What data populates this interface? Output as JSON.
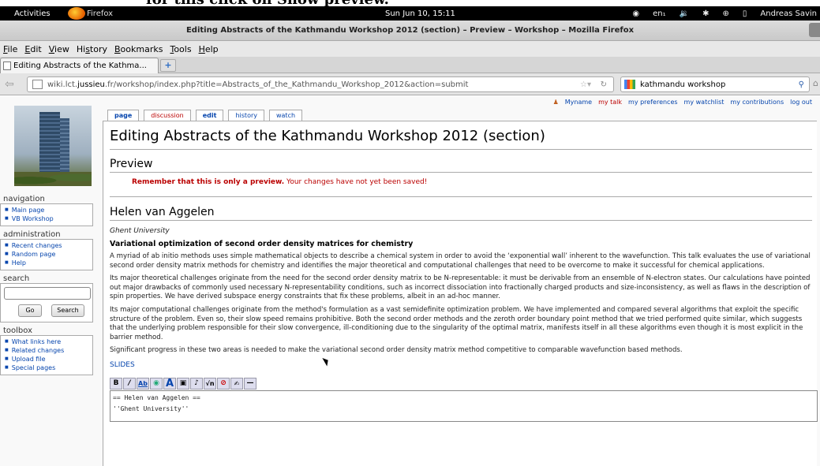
{
  "overlay": {
    "caption": "for this click on Show preview."
  },
  "gnome": {
    "activities": "Activities",
    "app_name": "Firefox",
    "clock": "Sun Jun 10, 15:11",
    "tray": [
      "en₁",
      "🔉",
      "✱",
      "⊕",
      "▯",
      "Andreas Savin"
    ]
  },
  "window": {
    "title": "Editing Abstracts of the Kathmandu Workshop 2012 (section) – Preview – Workshop – Mozilla Firefox"
  },
  "menu": [
    {
      "label": "File",
      "u": "F"
    },
    {
      "label": "Edit",
      "u": "E"
    },
    {
      "label": "View",
      "u": "V"
    },
    {
      "label": "History",
      "u": "s"
    },
    {
      "label": "Bookmarks",
      "u": "B"
    },
    {
      "label": "Tools",
      "u": "T"
    },
    {
      "label": "Help",
      "u": "H"
    }
  ],
  "tab": {
    "label": "Editing Abstracts of the Kathma..."
  },
  "url": {
    "prefix": "wiki.lct.",
    "host": "jussieu",
    "rest": ".fr/workshop/index.php?title=Abstracts_of_the_Kathmandu_Workshop_2012&action=submit"
  },
  "search": {
    "value": "kathmandu workshop"
  },
  "personal": [
    "Myname",
    "my talk",
    "my preferences",
    "my watchlist",
    "my contributions",
    "log out"
  ],
  "content_tabs": [
    "page",
    "discussion",
    "edit",
    "history",
    "watch"
  ],
  "sidebar": {
    "navigation": {
      "title": "navigation",
      "items": [
        "Main page",
        "VB Workshop"
      ]
    },
    "administration": {
      "title": "administration",
      "items": [
        "Recent changes",
        "Random page",
        "Help"
      ]
    },
    "search": {
      "title": "search",
      "go": "Go",
      "search": "Search"
    },
    "toolbox": {
      "title": "toolbox",
      "items": [
        "What links here",
        "Related changes",
        "Upload file",
        "Special pages"
      ]
    }
  },
  "page": {
    "title": "Editing Abstracts of the Kathmandu Workshop 2012 (section)",
    "preview_heading": "Preview",
    "preview_bold": "Remember that this is only a preview.",
    "preview_rest": " Your changes have not yet been saved!",
    "speaker": "Helen van Aggelen",
    "affiliation": "Ghent University",
    "talk_title": "Variational optimization of second order density matrices for chemistry",
    "paragraphs": [
      "A myriad of ab initio methods uses simple mathematical objects to describe a chemical system in order to avoid the ‘exponential wall’ inherent to the wavefunction. This talk evaluates the use of variational second order density matrix methods for chemistry and identifies the major theoretical and computational challenges that need to be overcome to make it successful for chemical applications.",
      "Its major theoretical challenges originate from the need for the second order density matrix to be N-representable: it must be derivable from an ensemble of N-electron states. Our calculations have pointed out major drawbacks of commonly used necessary N-representability conditions, such as incorrect dissociation into fractionally charged products and size-inconsistency, as well as flaws in the description of spin properties. We have derived subspace energy constraints that fix these problems, albeit in an ad-hoc manner.",
      "Its major computational challenges originate from the method's formulation as a vast semidefinite optimization problem. We have implemented and compared several algorithms that exploit the specific structure of the problem. Even so, their slow speed remains prohibitive. Both the second order methods and the zeroth order boundary point method that we tried performed quite similar, which suggests that the underlying problem responsible for their slow convergence, ill-conditioning due to the singularity of the optimal matrix, manifests itself in all these algorithms even though it is most explicit in the barrier method.",
      "Significant progress in these two areas is needed to make the variational second order density matrix method competitive to comparable wavefunction based methods."
    ],
    "slides": "SLIDES",
    "editor_lines": [
      "== Helen van Aggelen ==",
      "''Ghent University''"
    ]
  }
}
